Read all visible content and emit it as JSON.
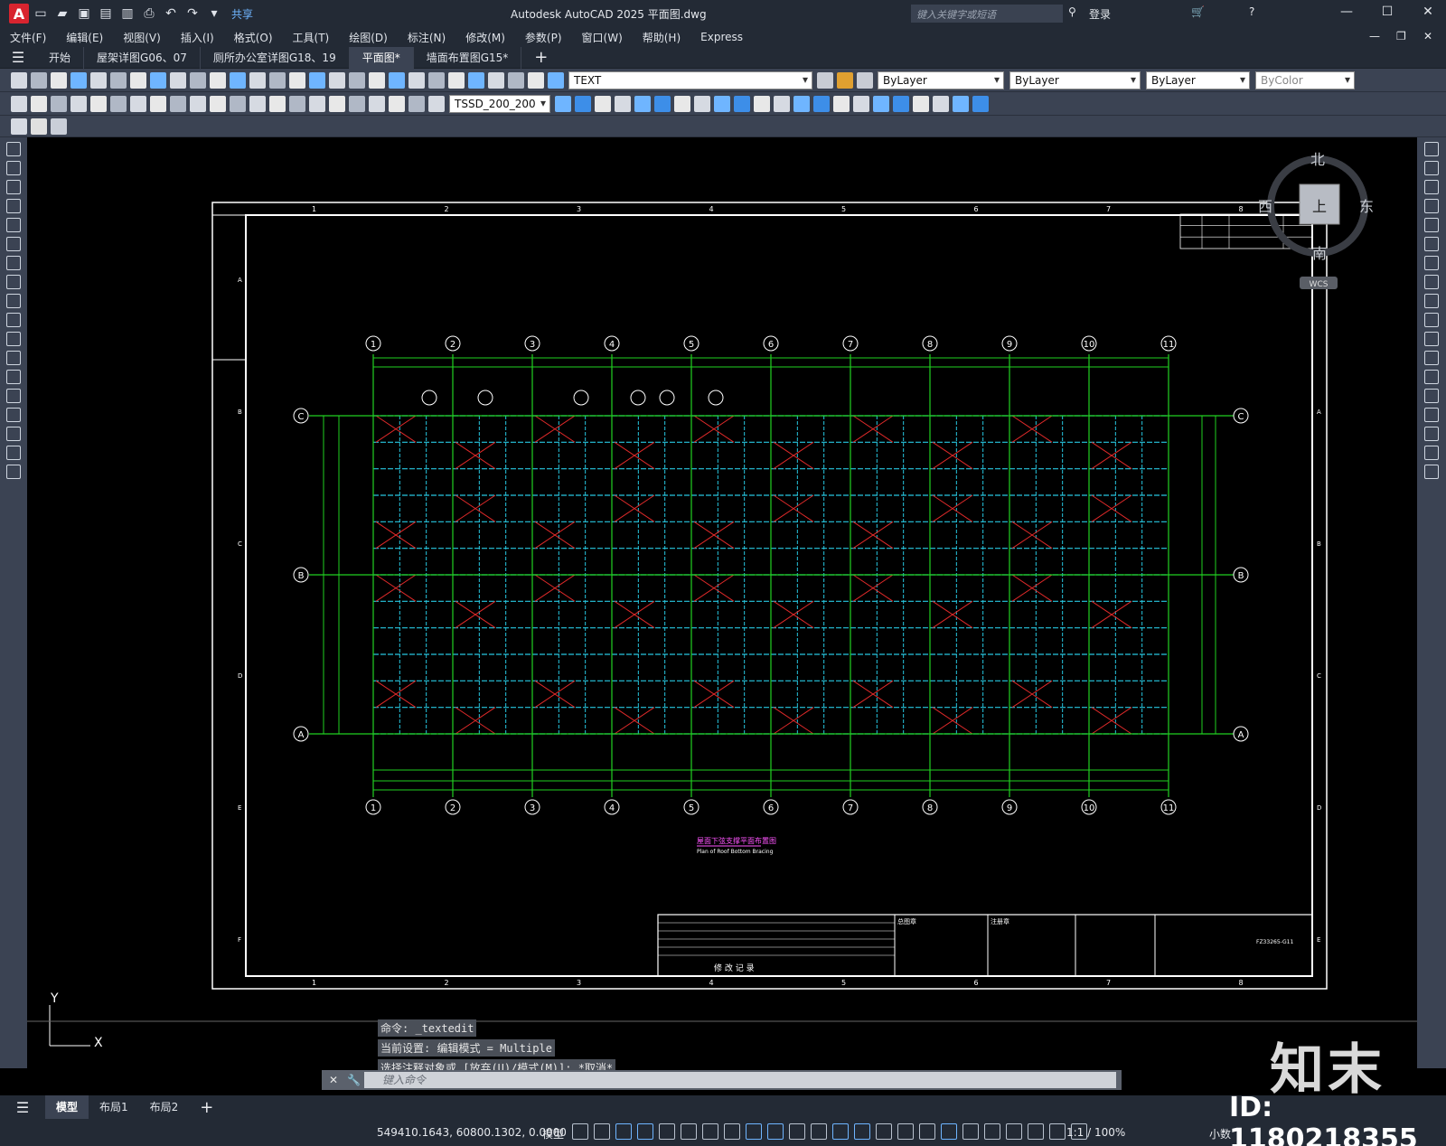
{
  "titlebar": {
    "logo": "A",
    "share_label": "共享",
    "title": "Autodesk AutoCAD 2025    平面图.dwg",
    "search_placeholder": "键入关键字或短语",
    "login_label": "登录"
  },
  "menubar": {
    "items": [
      "文件(F)",
      "编辑(E)",
      "视图(V)",
      "插入(I)",
      "格式(O)",
      "工具(T)",
      "绘图(D)",
      "标注(N)",
      "修改(M)",
      "参数(P)",
      "窗口(W)",
      "帮助(H)",
      "Express"
    ]
  },
  "tabs": [
    {
      "label": "开始",
      "active": false
    },
    {
      "label": "屋架详图G06、07",
      "active": false
    },
    {
      "label": "厕所办公室详图G18、19",
      "active": false
    },
    {
      "label": "平面图*",
      "active": true
    },
    {
      "label": "墙面布置图G15*",
      "active": false
    }
  ],
  "properties": {
    "text_style": "TEXT",
    "layer": "ByLayer",
    "linetype": "ByLayer",
    "lineweight": "ByLayer",
    "color": "ByColor",
    "dim_style": "TSSD_200_200"
  },
  "viewcube": {
    "north": "北",
    "south": "南",
    "east": "东",
    "west": "西",
    "face": "上",
    "wcs": "WCS"
  },
  "drawing": {
    "plan_title_cn": "屋面下弦支撑平面布置图",
    "plan_title_en": "Plan of Roof Bottom Bracing",
    "col_axes": [
      "1",
      "2",
      "3",
      "4",
      "5",
      "6",
      "7",
      "8",
      "9",
      "10",
      "11"
    ],
    "row_axes": [
      "A",
      "B",
      "C"
    ],
    "frame_cols": [
      "1",
      "2",
      "3",
      "4",
      "5",
      "6",
      "7",
      "8"
    ],
    "frame_rows": [
      "A",
      "B",
      "C",
      "D",
      "E",
      "F"
    ],
    "revision_label": "修  改  记  录",
    "stamp1": "总图章",
    "stamp2": "注册章",
    "drawing_no": "FZ33265-G11"
  },
  "command": {
    "history": [
      "命令: _textedit",
      "当前设置: 编辑模式 = Multiple",
      "选择注释对象或 [放弃(U)/模式(M)]: *取消*"
    ],
    "input_placeholder": "键入命令"
  },
  "layout_tabs": [
    "模型",
    "布局1",
    "布局2"
  ],
  "status": {
    "coords": "549410.1643, 60800.1302, 0.0000",
    "model_label": "模型",
    "scale": "1:1 / 100%",
    "units": "小数"
  },
  "watermark": {
    "logo": "知末",
    "id": "ID: 1180218355"
  },
  "colors": {
    "grid_green": "#21d021",
    "beam_cyan": "#27c6e0",
    "brace_red": "#e02a2a",
    "frame_white": "#ffffff",
    "ui_dark": "#232a35",
    "ui_panel": "#3b4353"
  }
}
